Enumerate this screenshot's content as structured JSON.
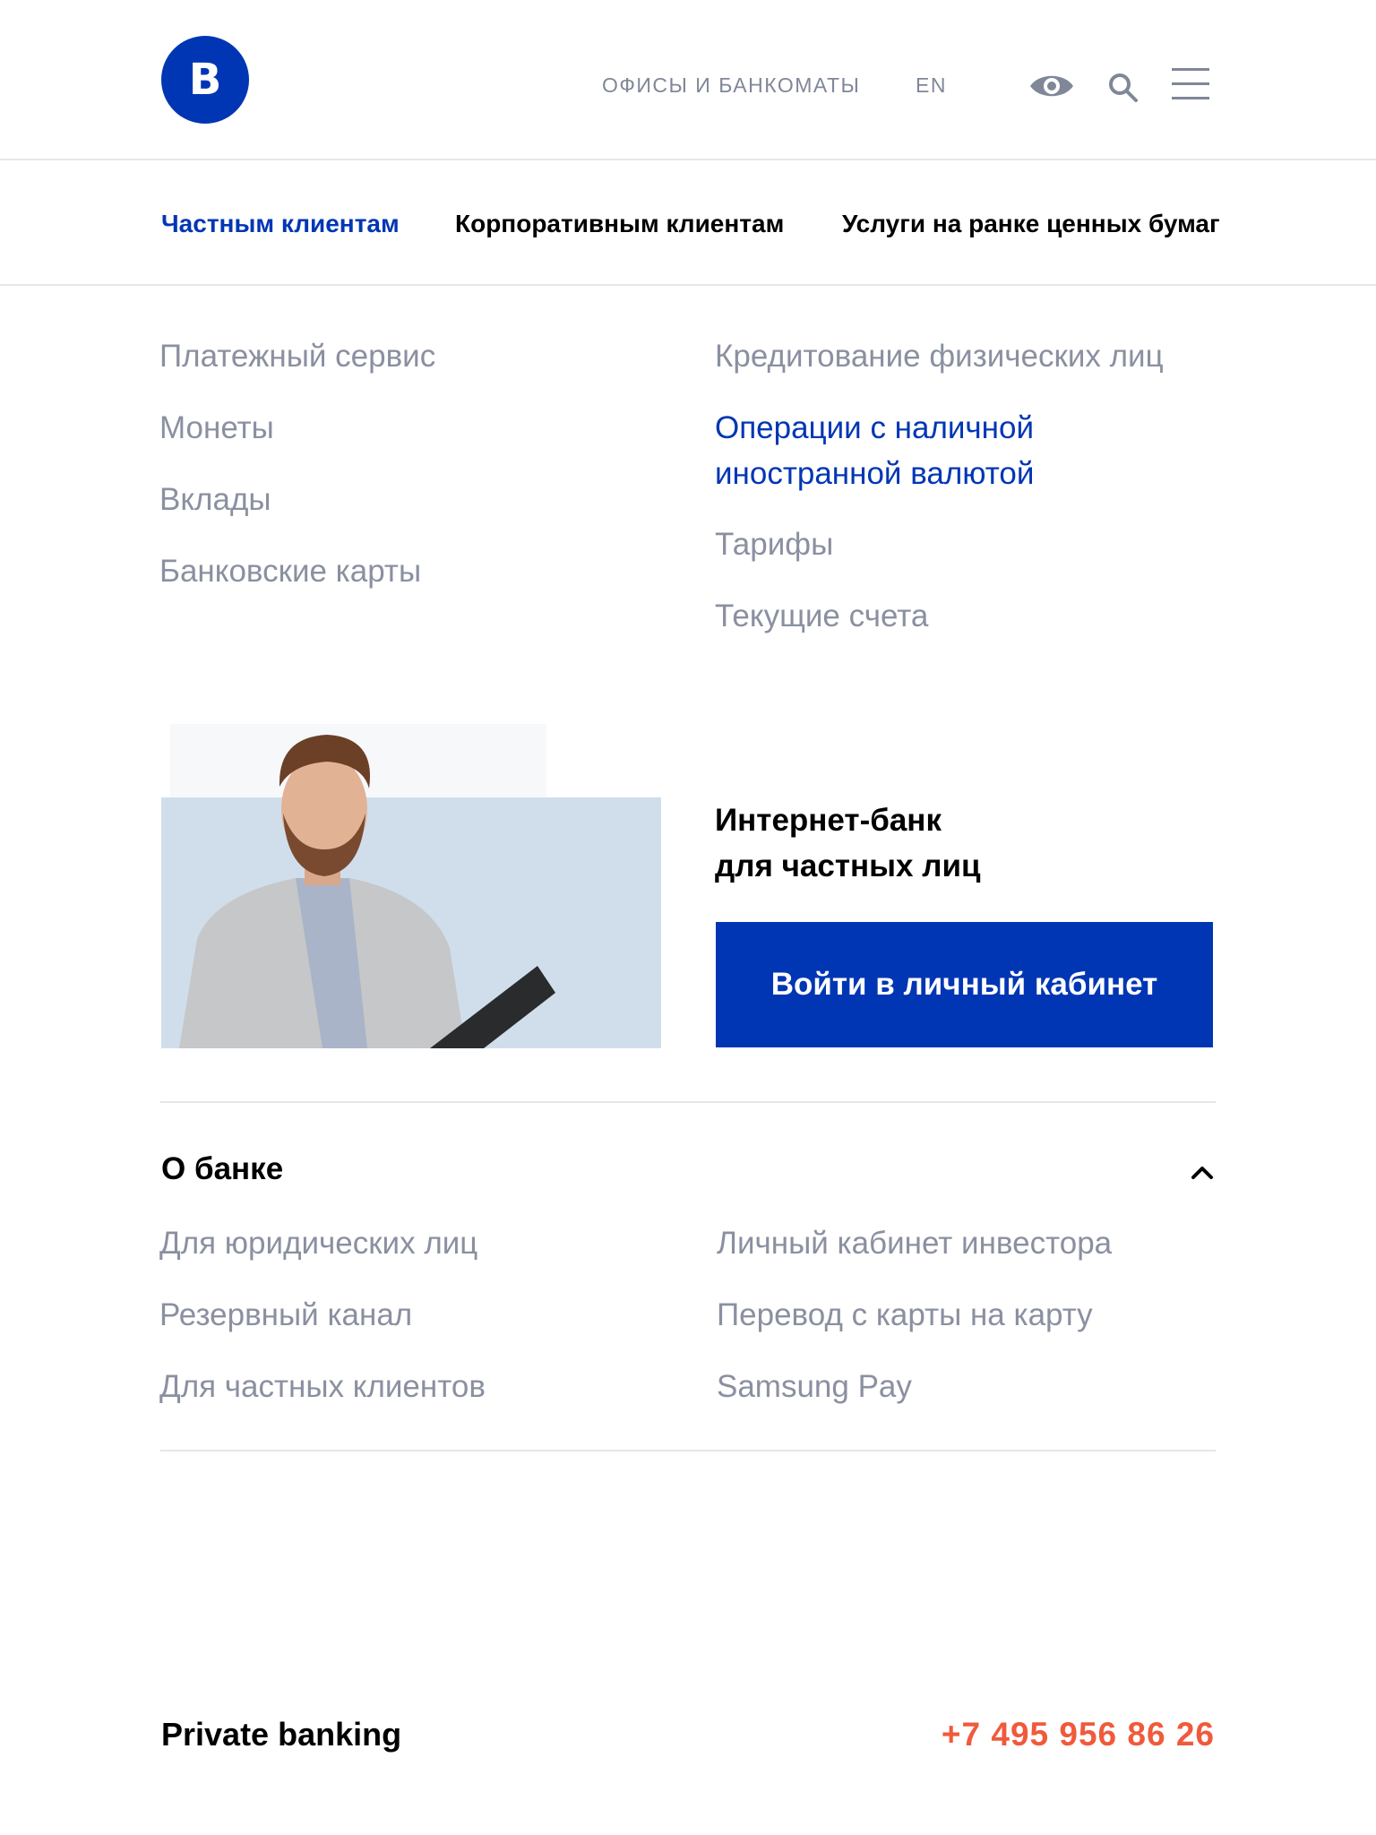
{
  "header": {
    "logo_letter": "В",
    "offices_link": "ОФИСЫ И БАНКОМАТЫ",
    "lang_link": "EN",
    "icons": [
      "eye-icon",
      "search-icon",
      "menu-icon"
    ]
  },
  "tabs": [
    {
      "label": "Частным клиентам",
      "active": true
    },
    {
      "label": "Корпоративным клиентам",
      "active": false
    },
    {
      "label": "Услуги на ранке ценных бумаг",
      "active": false
    }
  ],
  "menu": {
    "left": [
      "Платежный сервис",
      "Монеты",
      "Вклады",
      "Банковские карты"
    ],
    "right": [
      "Кредитование физических лиц",
      "Операции с наличной иностранной валютой",
      "Тарифы",
      "Текущие счета"
    ]
  },
  "promo": {
    "title_line1": "Интернет-банк",
    "title_line2": "для частных лиц",
    "button": "Войти в личный кабинет"
  },
  "about": {
    "title": "О банке",
    "left": [
      "Для юридических лиц",
      "Резервный канал",
      "Для частных клиентов"
    ],
    "right": [
      "Личный кабинет инвестора",
      "Перевод с карты на карту",
      "Samsung Pay"
    ]
  },
  "footer": {
    "label": "Private banking",
    "phone": "+7 495 956 86 26"
  },
  "colors": {
    "brand": "#0036b4",
    "muted_text": "#8a90a0",
    "phone": "#f05a3c",
    "photo_bg": "#d0deeb"
  }
}
